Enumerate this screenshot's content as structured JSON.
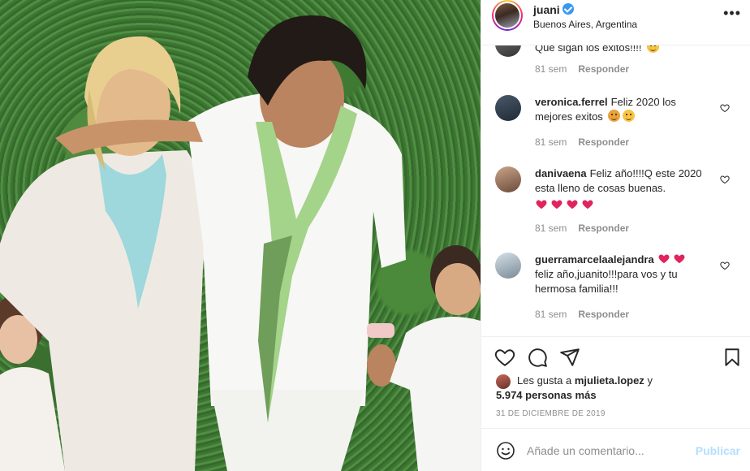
{
  "post": {
    "username": "juani",
    "location": "Buenos Aires, Argentina",
    "verified_icon": "verified-badge-icon",
    "more_icon": "more-options-icon",
    "more_label": "•••"
  },
  "comments": [
    {
      "user": "",
      "text": "Que sigan los exitos!!!! ",
      "emoji": "smiling-face-emoji",
      "time": "81 sem",
      "reply": "Responder"
    },
    {
      "user": "veronica.ferrel",
      "text": "Feliz 2020 los mejores exitos ",
      "emoji": "party-popper-emoji",
      "time": "81 sem",
      "reply": "Responder"
    },
    {
      "user": "danivaena",
      "text": "Feliz año!!!!Q este 2020 esta lleno de cosas buenas.",
      "emoji": "red-hearts-emoji",
      "time": "81 sem",
      "reply": "Responder"
    },
    {
      "user": "guerramarcelaalejandra",
      "text": "feliz año,juanito!!!para vos y tu hermosa familia!!!",
      "emoji": "red-hearts-emoji",
      "time": "81 sem",
      "reply": "Responder"
    }
  ],
  "likes": {
    "prefix": "Les gusta a",
    "user": "mjulieta.lopez",
    "suffix": "y",
    "count_text": "5.974 personas más"
  },
  "date": "31 DE DICIEMBRE DE 2019",
  "composer": {
    "placeholder": "Añade un comentario...",
    "publish_label": "Publicar"
  },
  "colors": {
    "accent": "#0095f6",
    "publish_disabled": "#b2dffc",
    "muted": "#8e8e8e",
    "heart": "#ed4956",
    "verified": "#3897f0"
  }
}
